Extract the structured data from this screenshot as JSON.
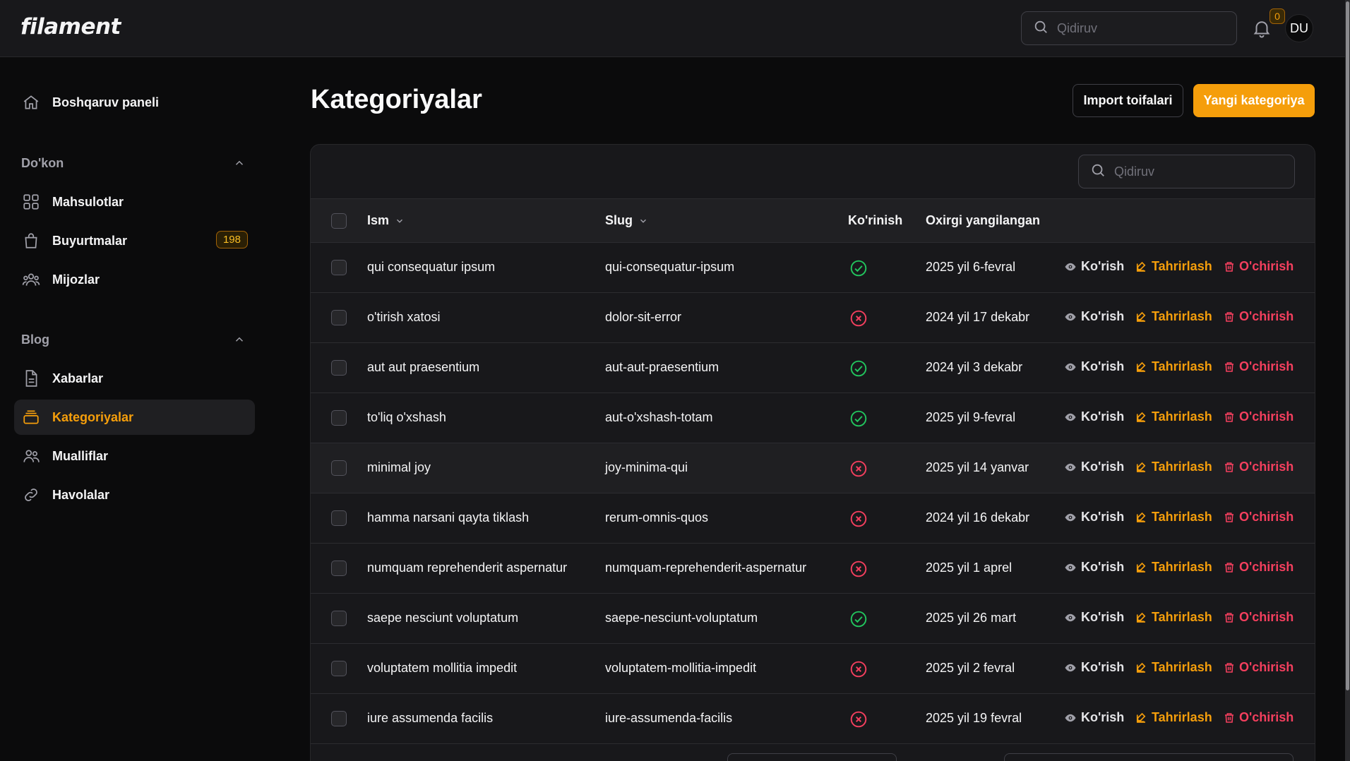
{
  "app": {
    "logo": "filament"
  },
  "header": {
    "search_placeholder": "Qidiruv",
    "notifications_count": "0",
    "avatar_initials": "DU"
  },
  "sidebar": {
    "dashboard": "Boshqaruv paneli",
    "groups": [
      {
        "label": "Do'kon",
        "items": [
          {
            "label": "Mahsulotlar",
            "icon": "grid-icon"
          },
          {
            "label": "Buyurtmalar",
            "icon": "shopping-bag-icon",
            "badge": "198"
          },
          {
            "label": "Mijozlar",
            "icon": "users-icon"
          }
        ]
      },
      {
        "label": "Blog",
        "items": [
          {
            "label": "Xabarlar",
            "icon": "document-icon"
          },
          {
            "label": "Kategoriyalar",
            "icon": "rectangle-stack-icon",
            "active": true
          },
          {
            "label": "Mualliflar",
            "icon": "user-group-icon"
          },
          {
            "label": "Havolalar",
            "icon": "link-icon"
          }
        ]
      }
    ]
  },
  "page": {
    "title": "Kategoriyalar",
    "import_button": "Import toifalari",
    "new_button": "Yangi kategoriya"
  },
  "table": {
    "search_placeholder": "Qidiruv",
    "columns": {
      "name": "Ism",
      "slug": "Slug",
      "visibility": "Ko'rinish",
      "updated": "Oxirgi yangilangan"
    },
    "actions": {
      "view": "Ko'rish",
      "edit": "Tahrirlash",
      "delete": "O'chirish"
    },
    "rows": [
      {
        "name": "qui consequatur ipsum",
        "slug": "qui-consequatur-ipsum",
        "visible": true,
        "updated": "2025 yil 6-fevral"
      },
      {
        "name": "o'tirish xatosi",
        "slug": "dolor-sit-error",
        "visible": false,
        "updated": "2024 yil 17 dekabr"
      },
      {
        "name": "aut aut praesentium",
        "slug": "aut-aut-praesentium",
        "visible": true,
        "updated": "2024 yil 3 dekabr"
      },
      {
        "name": "to'liq o'xshash",
        "slug": "aut-o'xshash-totam",
        "visible": true,
        "updated": "2025 yil 9-fevral"
      },
      {
        "name": "minimal joy",
        "slug": "joy-minima-qui",
        "visible": false,
        "updated": "2025 yil 14 yanvar"
      },
      {
        "name": "hamma narsani qayta tiklash",
        "slug": "rerum-omnis-quos",
        "visible": false,
        "updated": "2024 yil 16 dekabr"
      },
      {
        "name": "numquam reprehenderit aspernatur",
        "slug": "numquam-reprehenderit-aspernatur",
        "visible": false,
        "updated": "2025 yil 1 aprel"
      },
      {
        "name": "saepe nesciunt voluptatum",
        "slug": "saepe-nesciunt-voluptatum",
        "visible": true,
        "updated": "2025 yil 26 mart"
      },
      {
        "name": "voluptatem mollitia impedit",
        "slug": "voluptatem-mollitia-impedit",
        "visible": false,
        "updated": "2025 yil 2 fevral"
      },
      {
        "name": "iure assumenda facilis",
        "slug": "iure-assumenda-facilis",
        "visible": false,
        "updated": "2025 yil 19 fevral"
      }
    ]
  },
  "colors": {
    "accent": "#f59e0b",
    "success": "#22c55e",
    "danger": "#f43f5e"
  }
}
